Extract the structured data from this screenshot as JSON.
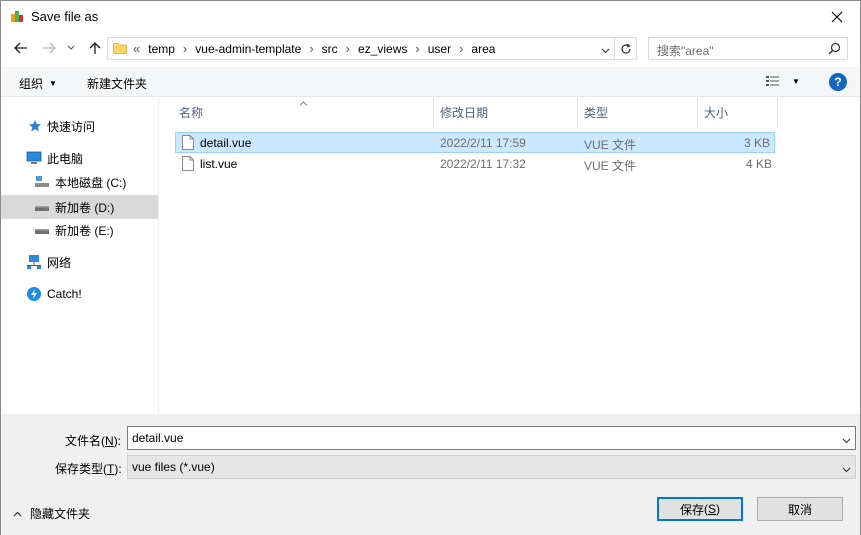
{
  "window": {
    "title": "Save file as"
  },
  "address": {
    "overflow": "«",
    "crumbs": [
      "temp",
      "vue-admin-template",
      "src",
      "ez_views",
      "user",
      "area"
    ]
  },
  "search": {
    "placeholder": "搜索\"area\""
  },
  "toolbar": {
    "organize_label": "组织",
    "new_folder_label": "新建文件夹",
    "help_label": "?"
  },
  "sidebar": {
    "items": [
      {
        "label": "快速访问",
        "icon": "star-icon"
      },
      {
        "label": "此电脑",
        "icon": "computer-icon"
      },
      {
        "label": "本地磁盘 (C:)",
        "icon": "drive-c-icon"
      },
      {
        "label": "新加卷 (D:)",
        "icon": "drive-icon",
        "selected": true
      },
      {
        "label": "新加卷 (E:)",
        "icon": "drive-icon"
      },
      {
        "label": "网络",
        "icon": "network-icon"
      },
      {
        "label": "Catch!",
        "icon": "catch-icon"
      }
    ]
  },
  "filelist": {
    "columns": [
      "名称",
      "修改日期",
      "类型",
      "大小"
    ],
    "rows": [
      {
        "name": "detail.vue",
        "modified": "2022/2/11 17:59",
        "type": "VUE 文件",
        "size": "3 KB",
        "selected": true
      },
      {
        "name": "list.vue",
        "modified": "2022/2/11 17:32",
        "type": "VUE 文件",
        "size": "4 KB",
        "selected": false
      }
    ]
  },
  "form": {
    "filename_label": "文件名",
    "filename_key": "N",
    "filename_value": "detail.vue",
    "filetype_label": "保存类型",
    "filetype_key": "T",
    "filetype_value": "vue files (*.vue)",
    "hide_folders_label": "隐藏文件夹",
    "save_label": "保存",
    "save_key": "S",
    "cancel_label": "取消"
  },
  "colors": {
    "accent": "#0078d7",
    "selection": "#cce8ff",
    "help": "#1565c0"
  }
}
